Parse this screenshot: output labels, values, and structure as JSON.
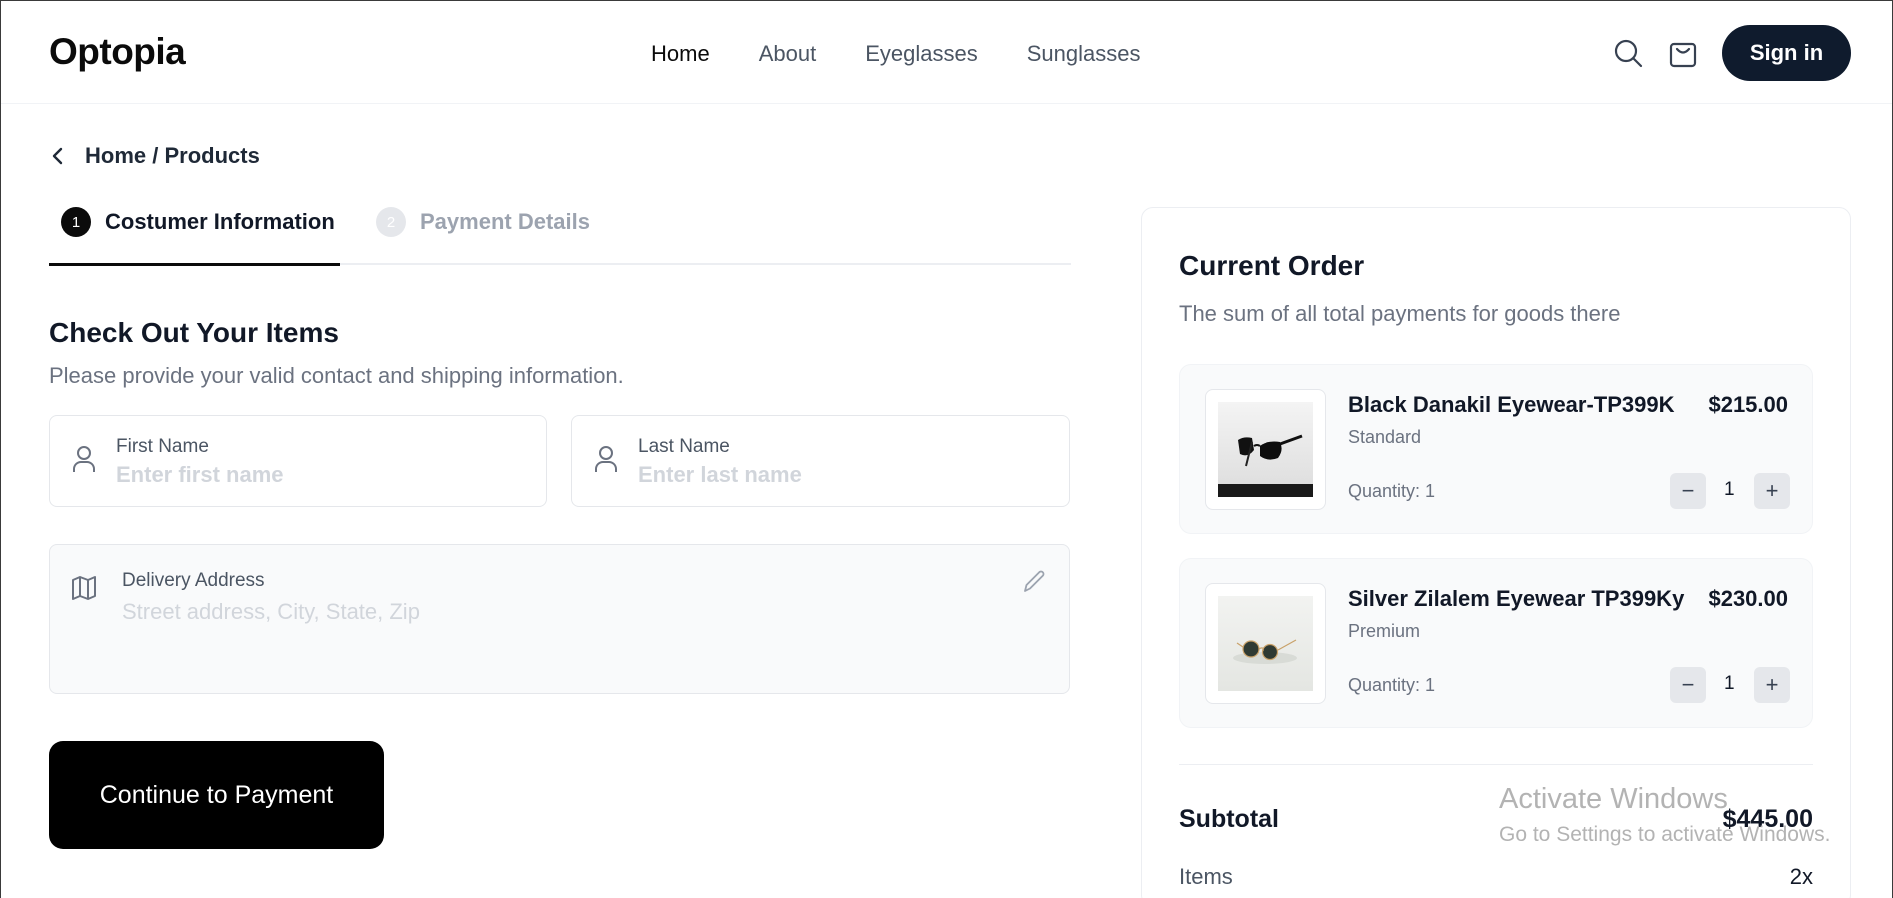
{
  "header": {
    "logo": "Optopia",
    "nav": [
      "Home",
      "About",
      "Eyeglasses",
      "Sunglasses"
    ],
    "active_nav": "Home",
    "signin_label": "Sign in",
    "icons": [
      "search-icon",
      "shopping-bag-icon"
    ]
  },
  "breadcrumb": {
    "text": "Home / Products"
  },
  "steps": [
    {
      "num": "1",
      "label": "Costumer Information",
      "active": true
    },
    {
      "num": "2",
      "label": "Payment Details",
      "active": false
    }
  ],
  "form": {
    "heading": "Check Out Your Items",
    "subheading": "Please provide your valid contact and shipping information.",
    "first_name": {
      "label": "First Name",
      "placeholder": "Enter first name",
      "value": ""
    },
    "last_name": {
      "label": "Last Name",
      "placeholder": "Enter last name",
      "value": ""
    },
    "address": {
      "label": "Delivery Address",
      "placeholder": "Street address, City, State, Zip",
      "value": ""
    },
    "continue_label": "Continue to Payment"
  },
  "order": {
    "title": "Current Order",
    "description": "The sum of all total payments for goods there",
    "items": [
      {
        "name": "Black Danakil Eyewear-TP399K",
        "tier": "Standard",
        "price": "$215.00",
        "quantity_label": "Quantity: 1",
        "quantity": "1"
      },
      {
        "name": "Silver Zilalem Eyewear TP399Ky",
        "tier": "Premium",
        "price": "$230.00",
        "quantity_label": "Quantity: 1",
        "quantity": "1"
      }
    ],
    "subtotal_label": "Subtotal",
    "subtotal_value": "$445.00",
    "items_label": "Items",
    "items_value": "2x"
  },
  "watermark": {
    "line1": "Activate Windows",
    "line2": "Go to Settings to activate Windows."
  },
  "colors": {
    "primary": "#0f1b2d",
    "cta": "#000000",
    "muted": "#6b7280"
  }
}
